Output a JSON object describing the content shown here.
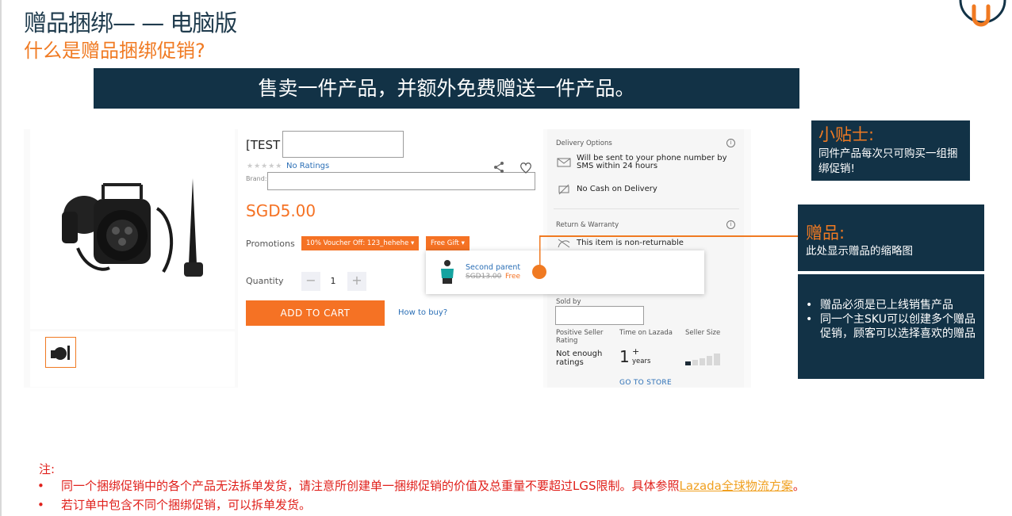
{
  "slide": {
    "title": "赠品捆绑— — 电脑版",
    "subtitle": "什么是赠品捆绑促销?",
    "banner": "售卖一件产品，并额外免费赠送一件产品。"
  },
  "product": {
    "title_prefix": "[TEST",
    "stars": "★★★★★",
    "rating_text": "No Ratings",
    "brand_label": "Brand:",
    "price": "SGD5.00",
    "promotions_label": "Promotions",
    "voucher_tag": "10% Voucher Off: 123_hehehe",
    "free_gift_tag": "Free Gift",
    "gift_popup": {
      "name": "Second parent",
      "old_price": "SGD13.00",
      "free_label": "Free"
    },
    "quantity_label": "Quantity",
    "quantity_minus": "−",
    "quantity_value": "1",
    "quantity_plus": "+",
    "add_to_cart": "ADD TO CART",
    "how_to_buy": "How to buy?"
  },
  "seller_panel": {
    "delivery_header": "Delivery Options",
    "delivery_sms": "Will be sent to your phone number by SMS within 24 hours",
    "no_cod": "No Cash on Delivery",
    "return_header": "Return & Warranty",
    "non_returnable": "This item is non-returnable",
    "sold_by": "Sold by",
    "positive_rating_label": "Positive Seller Rating",
    "positive_rating_value": "Not enough ratings",
    "time_label": "Time on Lazada",
    "time_value": "1",
    "time_plus": "+",
    "time_unit": "years",
    "size_label": "Seller Size",
    "go_to_store": "GO TO STORE"
  },
  "callouts": {
    "tip_title": "小贴士:",
    "tip_body": "同件产品每次只可购买一组捆绑促销!",
    "gift_title": "赠品:",
    "gift_body": "此处显示赠品的缩略图",
    "bullets": [
      "赠品必须是已上线销售产品",
      "同一个主SKU可以创建多个赠品促销，顾客可以选择喜欢的赠品"
    ]
  },
  "notes": {
    "header": "注:",
    "line1_text": "同一个捆绑促销中的各个产品无法拆单发货，请注意所创建单一捆绑促销的价值及总重量不要超过LGS限制。具体参照",
    "line1_link": "Lazada全球物流方案",
    "line1_end": "。",
    "line2": "若订单中包含不同个捆绑促销，可以拆单发货。"
  },
  "colors": {
    "navy": "#123246",
    "orange": "#f57224",
    "accent_orange": "#f07a22",
    "note_red": "#e0201b",
    "link_blue": "#2b6fb6"
  }
}
